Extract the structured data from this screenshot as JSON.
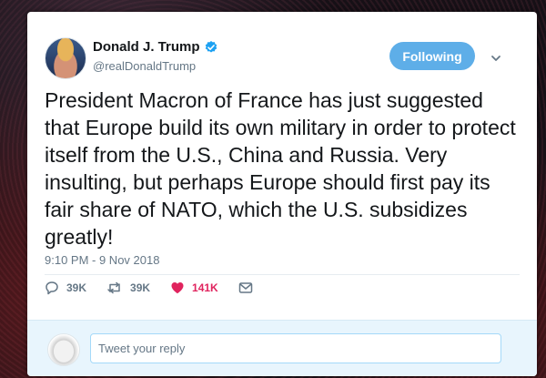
{
  "user": {
    "name": "Donald J. Trump",
    "handle": "@realDonaldTrump",
    "verified": true,
    "follow_label": "Following"
  },
  "tweet": {
    "text": "President Macron of France has just suggested that Europe build its own military in order to protect itself from the U.S., China and Russia. Very insulting, but perhaps Europe should first pay its fair share of NATO, which the U.S. subsidizes greatly!",
    "timestamp": "9:10 PM - 9 Nov 2018"
  },
  "actions": {
    "replies": "39K",
    "retweets": "39K",
    "likes": "141K"
  },
  "reply": {
    "placeholder": "Tweet your reply"
  },
  "colors": {
    "accent": "#5eaee8",
    "like": "#e0245e",
    "verified": "#1da1f2",
    "muted": "#657786"
  }
}
